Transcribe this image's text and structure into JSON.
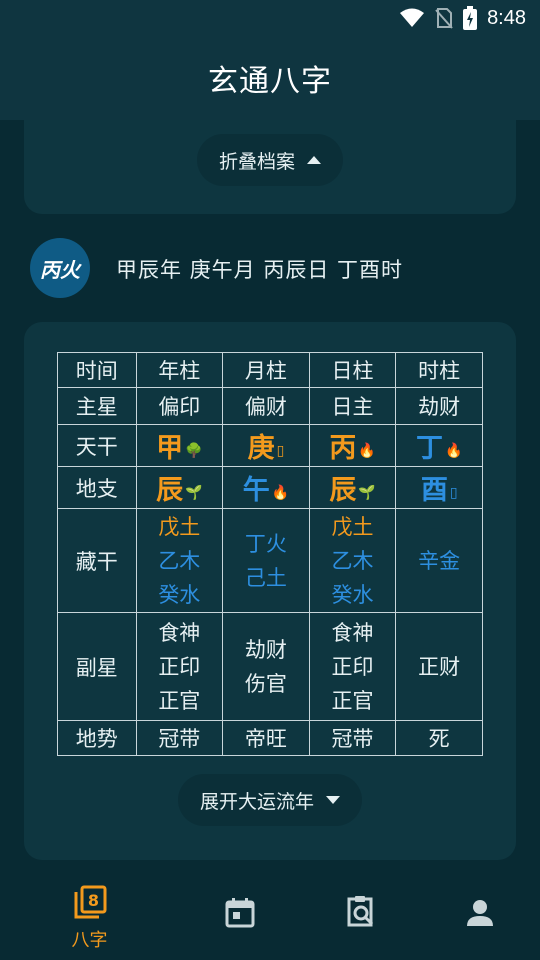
{
  "status": {
    "time": "8:48"
  },
  "app": {
    "title": "玄通八字"
  },
  "profile": {
    "collapse_label": "折叠档案"
  },
  "person": {
    "day_master": "丙火",
    "bazi": "甲辰年 庚午月 丙辰日 丁酉时"
  },
  "chart": {
    "header": [
      "时间",
      "年柱",
      "月柱",
      "日柱",
      "时柱"
    ],
    "main_star": {
      "label": "主星",
      "values": [
        "偏印",
        "偏财",
        "日主",
        "劫财"
      ]
    },
    "tiangan": {
      "label": "天干",
      "values": [
        {
          "char": "甲",
          "emoji": "🌳",
          "color": "#f39a1d"
        },
        {
          "char": "庚",
          "emoji": "▯",
          "color": "#f39a1d"
        },
        {
          "char": "丙",
          "emoji": "🔥",
          "color": "#f39a1d"
        },
        {
          "char": "丁",
          "emoji": "🔥",
          "color": "#2d8fe0"
        }
      ]
    },
    "dizhi": {
      "label": "地支",
      "values": [
        {
          "char": "辰",
          "emoji": "🌱",
          "color": "#f39a1d"
        },
        {
          "char": "午",
          "emoji": "🔥",
          "color": "#2d8fe0"
        },
        {
          "char": "辰",
          "emoji": "🌱",
          "color": "#f39a1d"
        },
        {
          "char": "酉",
          "emoji": "▯",
          "color": "#2d8fe0"
        }
      ]
    },
    "canggan": {
      "label": "藏干",
      "values": [
        [
          "戊土",
          "乙木",
          "癸水"
        ],
        [
          "丁火",
          "己土"
        ],
        [
          "戊土",
          "乙木",
          "癸水"
        ],
        [
          "辛金"
        ]
      ]
    },
    "canggan_colors": [
      [
        "#f39a1d",
        "#2d8fe0",
        "#2d8fe0"
      ],
      [
        "#2d8fe0",
        "#2d8fe0"
      ],
      [
        "#f39a1d",
        "#2d8fe0",
        "#2d8fe0"
      ],
      [
        "#2d8fe0"
      ]
    ],
    "fuxing": {
      "label": "副星",
      "values": [
        [
          "食神",
          "正印",
          "正官"
        ],
        [
          "劫财",
          "伤官"
        ],
        [
          "食神",
          "正印",
          "正官"
        ],
        [
          "正财"
        ]
      ]
    },
    "dishi": {
      "label": "地势",
      "values": [
        "冠带",
        "帝旺",
        "冠带",
        "死"
      ]
    }
  },
  "expand_label": "展开大运流年",
  "nav": {
    "bazi_label": "八字",
    "accent": "#f39a1d",
    "inactive": "#c9d5d8"
  }
}
